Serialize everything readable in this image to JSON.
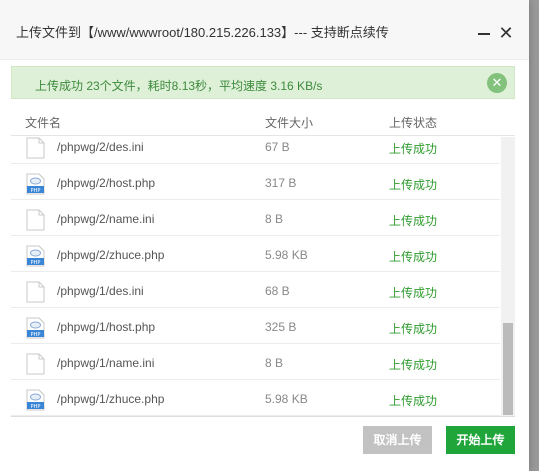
{
  "dialog": {
    "title": "上传文件到【/www/wwwroot/180.215.226.133】--- 支持断点续传",
    "minimize_icon": "minimize-icon",
    "close_icon": "close-icon",
    "close_glyph": "✕"
  },
  "alert": {
    "message": "上传成功 23个文件，耗时8.13秒，平均速度 3.16 KB/s",
    "close_glyph": "✕"
  },
  "table": {
    "headers": [
      "文件名",
      "文件大小",
      "上传状态"
    ],
    "rows": [
      {
        "name": "/phpwg/2/des.ini",
        "size": "67 B",
        "status": "上传成功",
        "icon": "file-icon"
      },
      {
        "name": "/phpwg/2/host.php",
        "size": "317 B",
        "status": "上传成功",
        "icon": "php-file-icon"
      },
      {
        "name": "/phpwg/2/name.ini",
        "size": "8 B",
        "status": "上传成功",
        "icon": "file-icon"
      },
      {
        "name": "/phpwg/2/zhuce.php",
        "size": "5.98 KB",
        "status": "上传成功",
        "icon": "php-file-icon"
      },
      {
        "name": "/phpwg/1/des.ini",
        "size": "68 B",
        "status": "上传成功",
        "icon": "file-icon"
      },
      {
        "name": "/phpwg/1/host.php",
        "size": "325 B",
        "status": "上传成功",
        "icon": "php-file-icon"
      },
      {
        "name": "/phpwg/1/name.ini",
        "size": "8 B",
        "status": "上传成功",
        "icon": "file-icon"
      },
      {
        "name": "/phpwg/1/zhuce.php",
        "size": "5.98 KB",
        "status": "上传成功",
        "icon": "php-file-icon"
      }
    ]
  },
  "footer": {
    "cancel_label": "取消上传",
    "start_label": "开始上传"
  },
  "colors": {
    "success_green": "#20a53a",
    "status_text": "#2f9c2f",
    "alert_bg": "#dff0d8",
    "pointer_arrow": "#e21b1b"
  }
}
